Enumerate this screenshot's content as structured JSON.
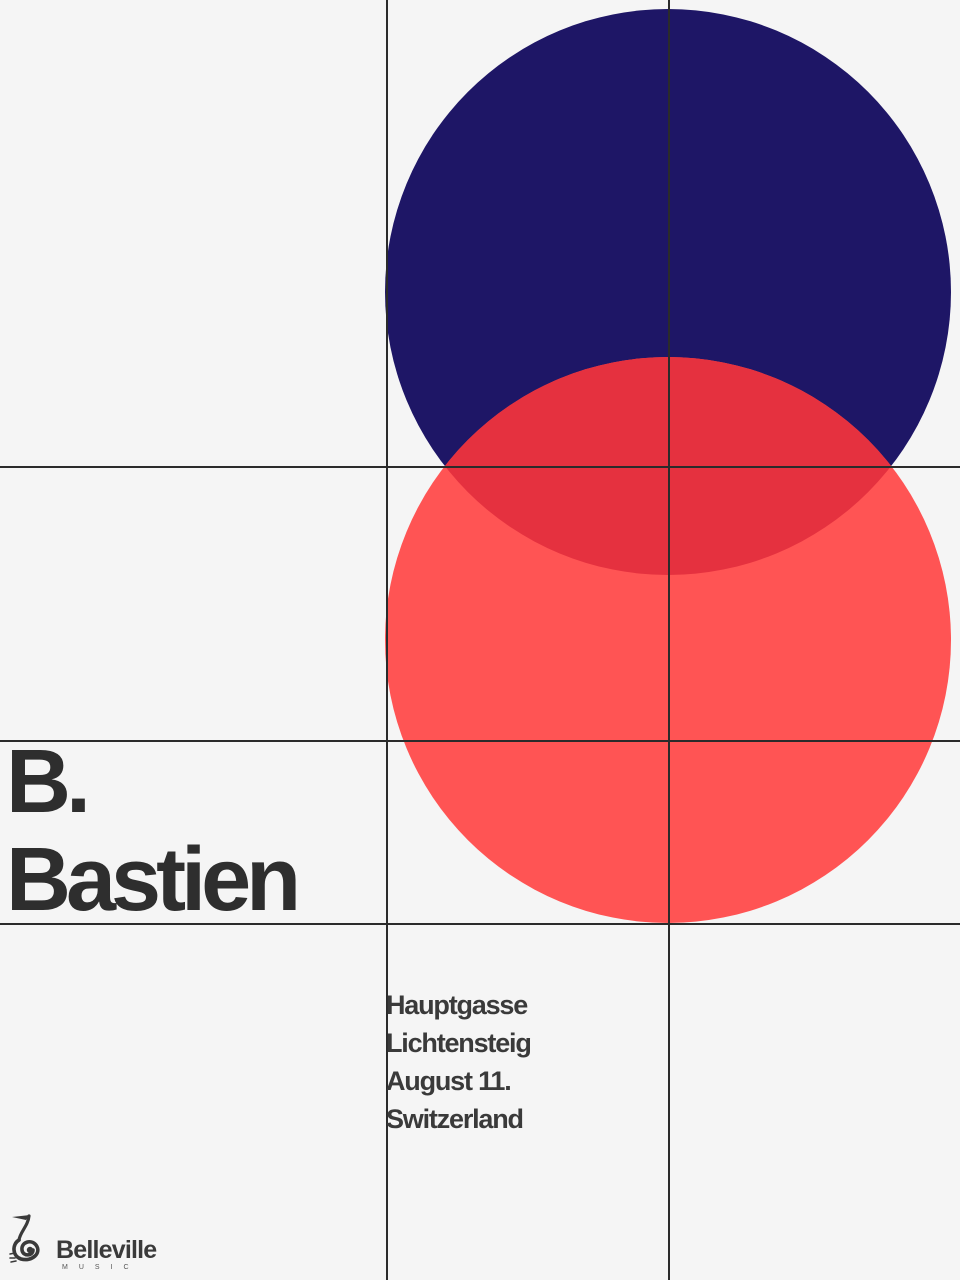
{
  "poster": {
    "headline": {
      "line1": "B.",
      "line2": "Bastien"
    },
    "details": {
      "street": "Hauptgasse",
      "town": "Lichtensteig",
      "date": "August 11.",
      "country": "Switzerland"
    },
    "logo": {
      "name": "Belleville",
      "subtitle": "MUSIC",
      "icon": "treble-clef-icon"
    }
  },
  "colors": {
    "background": "#f5f5f5",
    "navy_circle": "#1e1666",
    "red_circle": "#ff5454",
    "overlap": "#e5313f",
    "grid_lines": "#2b2b2b",
    "text": "#2e2e2e"
  }
}
